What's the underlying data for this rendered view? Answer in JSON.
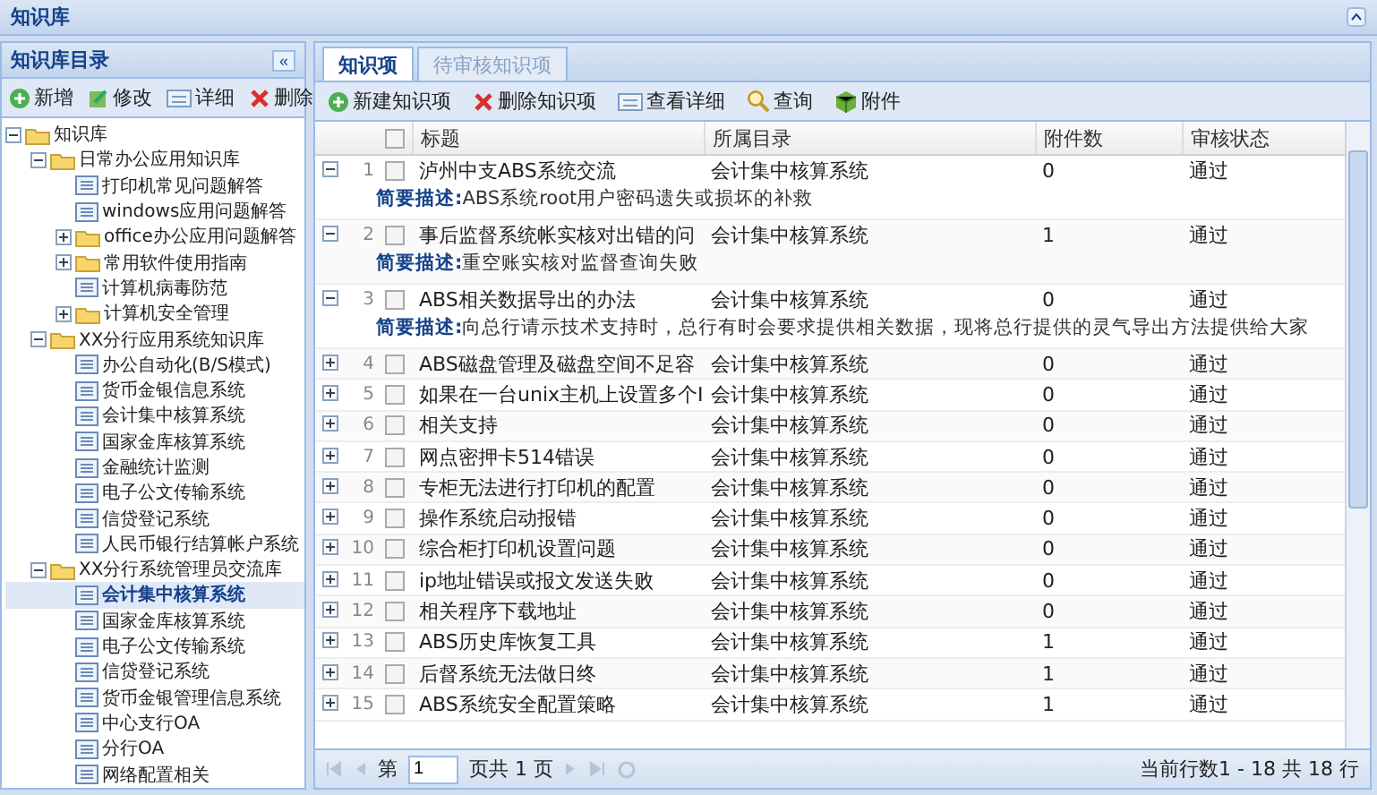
{
  "window": {
    "title": "知识库"
  },
  "sidebar": {
    "title": "知识库目录",
    "collapse_glyph": "«",
    "toolbar": [
      {
        "kind": "add",
        "label": "新增"
      },
      {
        "kind": "edit",
        "label": "修改"
      },
      {
        "kind": "detail",
        "label": "详细"
      },
      {
        "kind": "delete",
        "label": "删除"
      }
    ],
    "tree": [
      {
        "label": "知识库",
        "kind": "folder",
        "expanded": true,
        "selected": false,
        "children": [
          {
            "label": "日常办公应用知识库",
            "kind": "folder",
            "expanded": true,
            "selected": false,
            "children": [
              {
                "label": "打印机常见问题解答",
                "kind": "leaf",
                "selected": false
              },
              {
                "label": "windows应用问题解答",
                "kind": "leaf",
                "selected": false
              },
              {
                "label": "office办公应用问题解答",
                "kind": "folder",
                "expanded": false,
                "selected": false
              },
              {
                "label": "常用软件使用指南",
                "kind": "folder",
                "expanded": false,
                "selected": false
              },
              {
                "label": "计算机病毒防范",
                "kind": "leaf",
                "selected": false
              },
              {
                "label": "计算机安全管理",
                "kind": "folder",
                "expanded": false,
                "selected": false
              }
            ]
          },
          {
            "label": "XX分行应用系统知识库",
            "kind": "folder",
            "expanded": true,
            "selected": false,
            "children": [
              {
                "label": "办公自动化(B/S模式)",
                "kind": "leaf",
                "selected": false
              },
              {
                "label": "货币金银信息系统",
                "kind": "leaf",
                "selected": false
              },
              {
                "label": "会计集中核算系统",
                "kind": "leaf",
                "selected": false
              },
              {
                "label": "国家金库核算系统",
                "kind": "leaf",
                "selected": false
              },
              {
                "label": "金融统计监测",
                "kind": "leaf",
                "selected": false
              },
              {
                "label": "电子公文传输系统",
                "kind": "leaf",
                "selected": false
              },
              {
                "label": "信贷登记系统",
                "kind": "leaf",
                "selected": false
              },
              {
                "label": "人民币银行结算帐户系统",
                "kind": "leaf",
                "selected": false
              }
            ]
          },
          {
            "label": "XX分行系统管理员交流库",
            "kind": "folder",
            "expanded": true,
            "selected": false,
            "children": [
              {
                "label": "会计集中核算系统",
                "kind": "leaf",
                "selected": true
              },
              {
                "label": "国家金库核算系统",
                "kind": "leaf",
                "selected": false
              },
              {
                "label": "电子公文传输系统",
                "kind": "leaf",
                "selected": false
              },
              {
                "label": "信贷登记系统",
                "kind": "leaf",
                "selected": false
              },
              {
                "label": "货币金银管理信息系统",
                "kind": "leaf",
                "selected": false
              },
              {
                "label": "中心支行OA",
                "kind": "leaf",
                "selected": false
              },
              {
                "label": "分行OA",
                "kind": "leaf",
                "selected": false
              },
              {
                "label": "网络配置相关",
                "kind": "leaf",
                "selected": false
              }
            ]
          }
        ]
      }
    ]
  },
  "tabs": [
    {
      "label": "知识项",
      "selected": true
    },
    {
      "label": "待审核知识项",
      "selected": false
    }
  ],
  "toolbar": [
    {
      "kind": "add",
      "label": "新建知识项"
    },
    {
      "kind": "delete",
      "label": "删除知识项"
    },
    {
      "kind": "detail",
      "label": "查看详细"
    },
    {
      "kind": "search",
      "label": "查询"
    },
    {
      "kind": "attach",
      "label": "附件"
    }
  ],
  "table": {
    "columns": [
      "标题",
      "所属目录",
      "附件数",
      "审核状态"
    ],
    "all_checked": false,
    "rows": [
      {
        "num": "1",
        "title": "泸州中支ABS系统交流",
        "catalog": "会计集中核算系统",
        "attachments": "0",
        "status": "通过",
        "checked": false,
        "expanded": true,
        "desc_label": "简要描述:",
        "desc": "ABS系统root用户密码遗失或损坏的补救"
      },
      {
        "num": "2",
        "title": "事后监督系统帐实核对出错的问",
        "catalog": "会计集中核算系统",
        "attachments": "1",
        "status": "通过",
        "checked": false,
        "expanded": true,
        "desc_label": "简要描述:",
        "desc": "重空账实核对监督查询失败"
      },
      {
        "num": "3",
        "title": "ABS相关数据导出的办法",
        "catalog": "会计集中核算系统",
        "attachments": "0",
        "status": "通过",
        "checked": false,
        "expanded": true,
        "desc_label": "简要描述:",
        "desc": "向总行请示技术支持时，总行有时会要求提供相关数据，现将总行提供的灵气导出方法提供给大家"
      },
      {
        "num": "4",
        "title": "ABS磁盘管理及磁盘空间不足容",
        "catalog": "会计集中核算系统",
        "attachments": "0",
        "status": "通过",
        "checked": false,
        "expanded": false
      },
      {
        "num": "5",
        "title": "如果在一台unix主机上设置多个I",
        "catalog": "会计集中核算系统",
        "attachments": "0",
        "status": "通过",
        "checked": false,
        "expanded": false
      },
      {
        "num": "6",
        "title": "相关支持",
        "catalog": "会计集中核算系统",
        "attachments": "0",
        "status": "通过",
        "checked": false,
        "expanded": false
      },
      {
        "num": "7",
        "title": "网点密押卡514错误",
        "catalog": "会计集中核算系统",
        "attachments": "0",
        "status": "通过",
        "checked": false,
        "expanded": false
      },
      {
        "num": "8",
        "title": "专柜无法进行打印机的配置",
        "catalog": "会计集中核算系统",
        "attachments": "0",
        "status": "通过",
        "checked": false,
        "expanded": false
      },
      {
        "num": "9",
        "title": "操作系统启动报错",
        "catalog": "会计集中核算系统",
        "attachments": "0",
        "status": "通过",
        "checked": false,
        "expanded": false
      },
      {
        "num": "10",
        "title": "综合柜打印机设置问题",
        "catalog": "会计集中核算系统",
        "attachments": "0",
        "status": "通过",
        "checked": false,
        "expanded": false
      },
      {
        "num": "11",
        "title": "ip地址错误或报文发送失败",
        "catalog": "会计集中核算系统",
        "attachments": "0",
        "status": "通过",
        "checked": false,
        "expanded": false
      },
      {
        "num": "12",
        "title": "相关程序下载地址",
        "catalog": "会计集中核算系统",
        "attachments": "0",
        "status": "通过",
        "checked": false,
        "expanded": false
      },
      {
        "num": "13",
        "title": "ABS历史库恢复工具",
        "catalog": "会计集中核算系统",
        "attachments": "1",
        "status": "通过",
        "checked": false,
        "expanded": false
      },
      {
        "num": "14",
        "title": "后督系统无法做日终",
        "catalog": "会计集中核算系统",
        "attachments": "1",
        "status": "通过",
        "checked": false,
        "expanded": false
      },
      {
        "num": "15",
        "title": "ABS系统安全配置策略",
        "catalog": "会计集中核算系统",
        "attachments": "1",
        "status": "通过",
        "checked": false,
        "expanded": false
      }
    ]
  },
  "pager": {
    "before": "第",
    "page": "1",
    "after": "页共 1 页",
    "summary": "当前行数1 - 18 共 18 行"
  }
}
